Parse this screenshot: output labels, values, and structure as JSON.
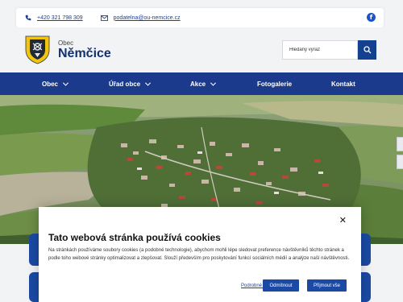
{
  "topbar": {
    "phone": "+420 321 798 309",
    "email": "podatelna@ou-nemcice.cz"
  },
  "brand": {
    "small": "Obec",
    "name": "Němčice"
  },
  "search": {
    "placeholder": "Hledaný výraz"
  },
  "nav": {
    "items": [
      {
        "label": "Obec"
      },
      {
        "label": "Úřad obce"
      },
      {
        "label": "Akce"
      },
      {
        "label": "Fotogalerie"
      },
      {
        "label": "Kontakt"
      }
    ]
  },
  "cookie": {
    "title": "Tato webová stránka používá cookies",
    "text": "Na stránkách používáme soubory cookies (a podobné technologie), abychom mohli lépe sledovat preference návštěvníků těchto stránek a podle toho webové stránky optimalizovat a zlepšovat. Slouží především pro poskytování funkcí sociálních médií a analýze naší návštěvnosti.",
    "settings_link": "Podrobné nastavení",
    "reject_label": "Odmítnout",
    "accept_label": "Přijmout vše"
  },
  "colors": {
    "primary": "#1b3a8c",
    "accent": "#1b4aa4",
    "title": "#13306f"
  }
}
